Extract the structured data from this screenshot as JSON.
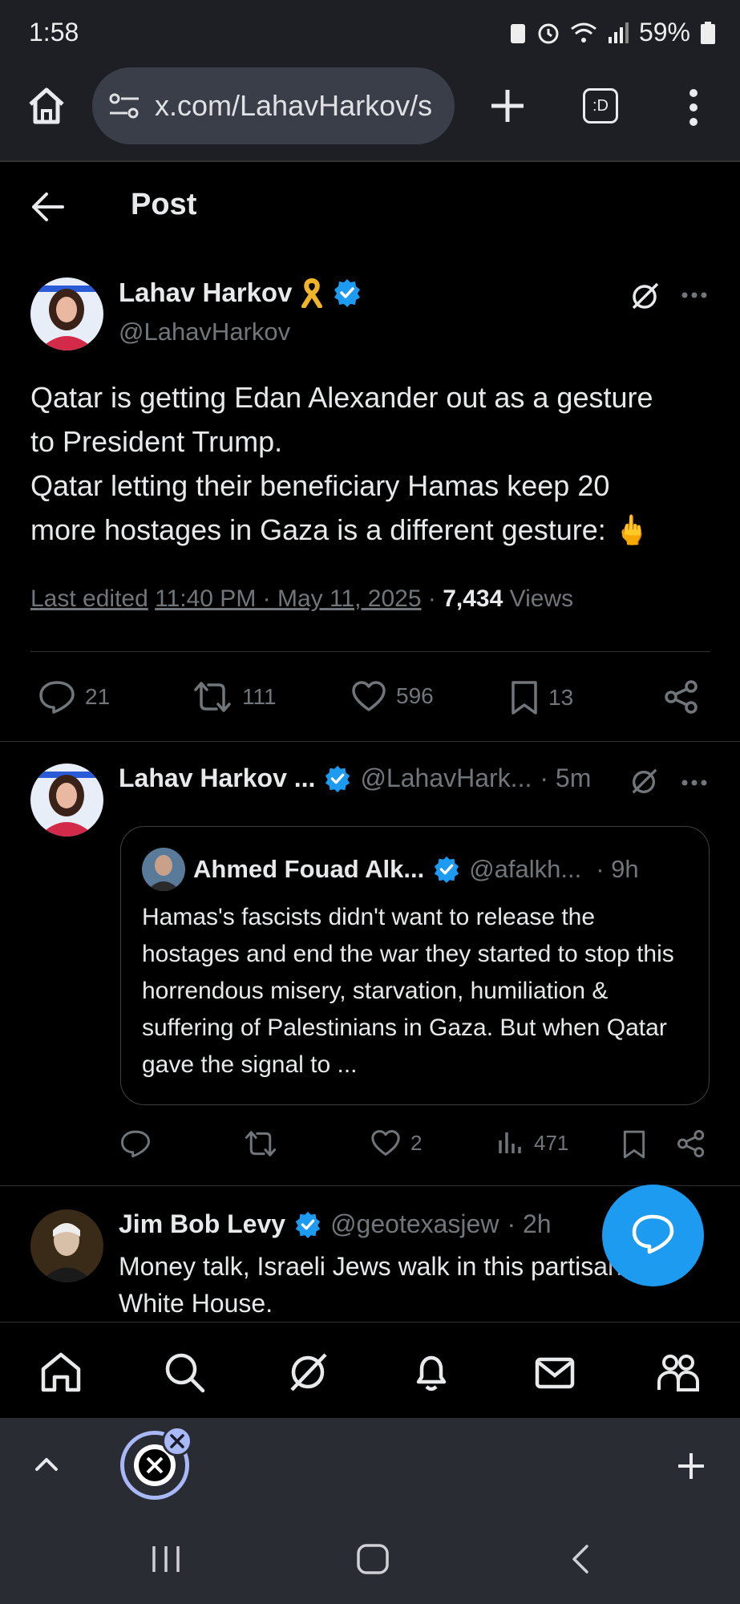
{
  "status_bar": {
    "time": "1:58",
    "battery": "59%"
  },
  "browser": {
    "url": "x.com/LahavHarkov/s",
    "tabs_label": ":D"
  },
  "header": {
    "title": "Post"
  },
  "post": {
    "author_name": "Lahav Harkov",
    "author_handle": "@LahavHarkov",
    "text_lines": [
      "Qatar is getting Edan Alexander out as a gesture",
      "to President Trump.",
      "Qatar letting their beneficiary Hamas keep 20",
      "more hostages in Gaza is a different gesture: 🖕"
    ],
    "last_edited": "Last edited",
    "timestamp": "11:40 PM · May 11, 2025",
    "views_count": "7,434",
    "views_label": "Views",
    "replies": "21",
    "reposts": "111",
    "likes": "596",
    "bookmarks": "13"
  },
  "reply1": {
    "author_name": "Lahav Harkov ...",
    "author_handle": "@LahavHark...",
    "time": "· 5m",
    "quote": {
      "author_name": "Ahmed Fouad Alk...",
      "author_handle": "@afalkh...",
      "time": "· 9h",
      "text": "Hamas's fascists didn't want to release the hostages and end the war they started to stop this horrendous misery, starvation, humiliation & suffering of Palestinians in Gaza. But when Qatar gave the signal to ..."
    },
    "likes": "2",
    "views": "471"
  },
  "reply2": {
    "author_name": "Jim Bob Levy",
    "author_handle": "@geotexasjew",
    "time": "· 2h",
    "text": "Money talk, Israeli Jews walk in this partisan White House."
  },
  "colors": {
    "accent": "#1d9bf0",
    "background": "#000000",
    "muted": "#71767b",
    "chrome": "#1d1f24"
  }
}
